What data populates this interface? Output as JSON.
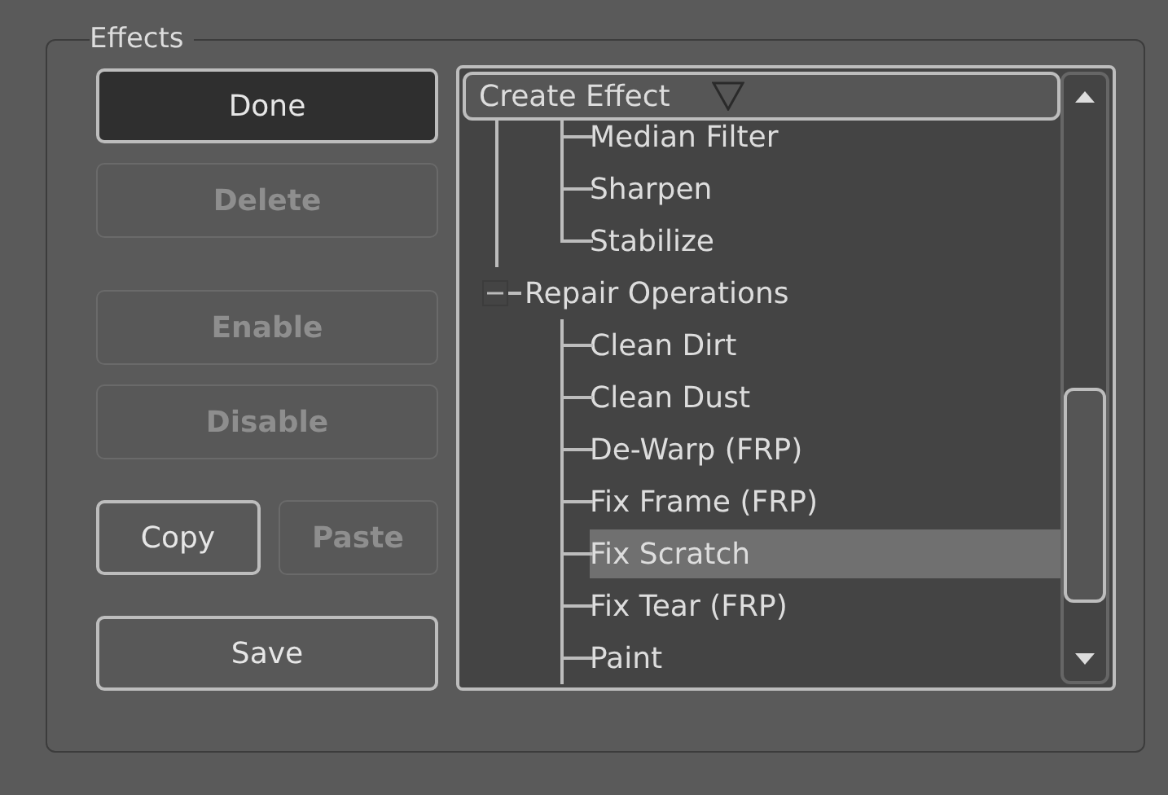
{
  "group_box": {
    "title": "Effects"
  },
  "button_groups": [
    {
      "kind": "stack",
      "buttons": [
        {
          "label": "Done",
          "disabled": false,
          "default": true
        },
        {
          "label": "Delete",
          "disabled": true,
          "default": false
        }
      ]
    },
    {
      "kind": "stack",
      "buttons": [
        {
          "label": "Enable",
          "disabled": true,
          "default": false
        },
        {
          "label": "Disable",
          "disabled": true,
          "default": false
        }
      ]
    },
    {
      "kind": "pair",
      "buttons": [
        {
          "label": "Copy",
          "disabled": false,
          "default": false
        },
        {
          "label": "Paste",
          "disabled": true,
          "default": false
        }
      ]
    },
    {
      "kind": "stack",
      "buttons": [
        {
          "label": "Save",
          "disabled": false,
          "default": false
        }
      ]
    }
  ],
  "effect_tree": {
    "dropdown": {
      "label": "Create Effect"
    },
    "items": [
      {
        "kind": "group",
        "children": [
          {
            "kind": "leaf",
            "label": "Median Filter",
            "selected": false
          },
          {
            "kind": "leaf",
            "label": "Sharpen",
            "selected": false
          },
          {
            "kind": "leaf",
            "label": "Stabilize",
            "selected": false
          }
        ]
      },
      {
        "kind": "group",
        "label": "Repair Operations",
        "expanded": true,
        "children": [
          {
            "kind": "leaf",
            "label": "Clean Dirt",
            "selected": false
          },
          {
            "kind": "leaf",
            "label": "Clean Dust",
            "selected": false
          },
          {
            "kind": "leaf",
            "label": "De-Warp (FRP)",
            "selected": false
          },
          {
            "kind": "leaf",
            "label": "Fix Frame (FRP)",
            "selected": false
          },
          {
            "kind": "leaf",
            "label": "Fix Scratch",
            "selected": true
          },
          {
            "kind": "leaf",
            "label": "Fix Tear (FRP)",
            "selected": false
          },
          {
            "kind": "leaf",
            "label": "Paint",
            "selected": false
          }
        ]
      }
    ]
  }
}
